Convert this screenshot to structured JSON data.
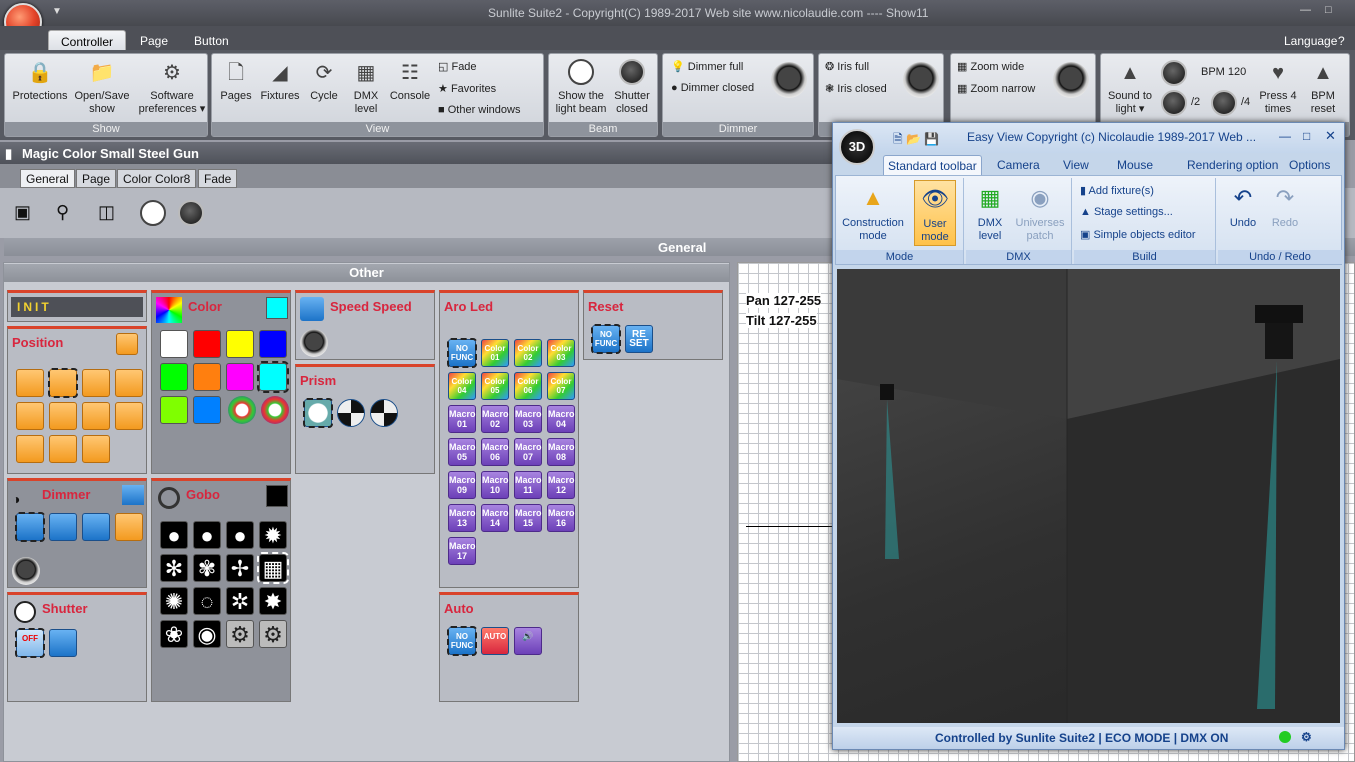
{
  "window": {
    "title": "Sunlite Suite2 - Copyright(C) 1989-2017    Web site www.nicolaudie.com ---- Show11"
  },
  "ribbon_tabs": [
    "Controller",
    "Page",
    "Button"
  ],
  "language_label": "Language",
  "help_label": "?",
  "groups": {
    "show": {
      "label": "Show",
      "protections": "Protections",
      "open_save": [
        "Open/Save",
        "show"
      ],
      "software": [
        "Software",
        "preferences"
      ]
    },
    "view": {
      "label": "View",
      "pages": "Pages",
      "fixtures": "Fixtures",
      "cycle": "Cycle",
      "dmx": [
        "DMX",
        "level"
      ],
      "console": "Console",
      "fade": "Fade",
      "favorites": "Favorites",
      "other_windows": "Other windows"
    },
    "beam": {
      "label": "Beam",
      "show_light": [
        "Show the",
        "light beam"
      ],
      "shutter_closed": [
        "Shutter",
        "closed"
      ]
    },
    "dimmer": {
      "label": "Dimmer",
      "full": "Dimmer full",
      "closed": "Dimmer closed"
    },
    "iris": {
      "full": "Iris full",
      "closed": "Iris closed"
    },
    "zoom": {
      "wide": "Zoom wide",
      "narrow": "Zoom narrow"
    },
    "bpm": {
      "sound": [
        "Sound to",
        "light"
      ],
      "bpm": "BPM 120",
      "div2": "/2",
      "div4": "/4",
      "press4": [
        "Press 4",
        "times"
      ],
      "reset": [
        "BPM",
        "reset"
      ]
    }
  },
  "fixture_title": "Magic Color Small Steel Gun",
  "page_tabs": [
    "General",
    "Page",
    "Color Color8",
    "Fade"
  ],
  "general_header": "General",
  "other_header": "Other",
  "boxes": {
    "init": "INIT",
    "position": "Position",
    "color": "Color",
    "speed": "Speed Speed",
    "prism": "Prism",
    "aroled": "Aro Led",
    "reset": "Reset",
    "dimmer": "Dimmer",
    "gobo": "Gobo",
    "shutter": "Shutter",
    "auto": "Auto"
  },
  "color_swatches": [
    "#ffffff",
    "#ff0000",
    "#ffff00",
    "#0000ff",
    "#00ff00",
    "#ff7f0f",
    "#ff00ff",
    "#00ffff",
    "#7fff00",
    "#0080ff"
  ],
  "aroled_buttons": [
    "NO FUNC",
    "Color 01",
    "Color 02",
    "Color 03",
    "Color 04",
    "Color 05",
    "Color 06",
    "Color 07",
    "Macro 01",
    "Macro 02",
    "Macro 03",
    "Macro 04",
    "Macro 05",
    "Macro 06",
    "Macro 07",
    "Macro 08",
    "Macro 09",
    "Macro 10",
    "Macro 11",
    "Macro 12",
    "Macro 13",
    "Macro 14",
    "Macro 15",
    "Macro 16",
    "Macro 17"
  ],
  "reset_buttons": [
    "NO FUNC",
    "RE SET"
  ],
  "auto_buttons": [
    "NO FUNC",
    "AUTO"
  ],
  "shutter_off": "OFF",
  "pan_tilt": {
    "pan": "Pan 127-255",
    "tilt": "Tilt 127-255"
  },
  "easyview": {
    "title": "Easy View   Copyright (c) Nicolaudie 1989-2017    Web ...",
    "logo": "3D",
    "tabs": [
      "Standard toolbar",
      "Camera",
      "View",
      "Mouse",
      "Rendering option"
    ],
    "options": "Options",
    "mode": {
      "label": "Mode",
      "construction": [
        "Construction",
        "mode"
      ],
      "user": [
        "User",
        "mode"
      ]
    },
    "dmx": {
      "label": "DMX",
      "level": [
        "DMX",
        "level"
      ],
      "universes": [
        "Universes",
        "patch"
      ]
    },
    "build": {
      "label": "Build",
      "add": "Add fixture(s)",
      "stage": "Stage settings...",
      "simple": "Simple objects editor"
    },
    "undo": {
      "label": "Undo / Redo",
      "undo": "Undo",
      "redo": "Redo"
    },
    "status": "Controlled by Sunlite Suite2   |   ECO MODE   |   DMX ON"
  }
}
